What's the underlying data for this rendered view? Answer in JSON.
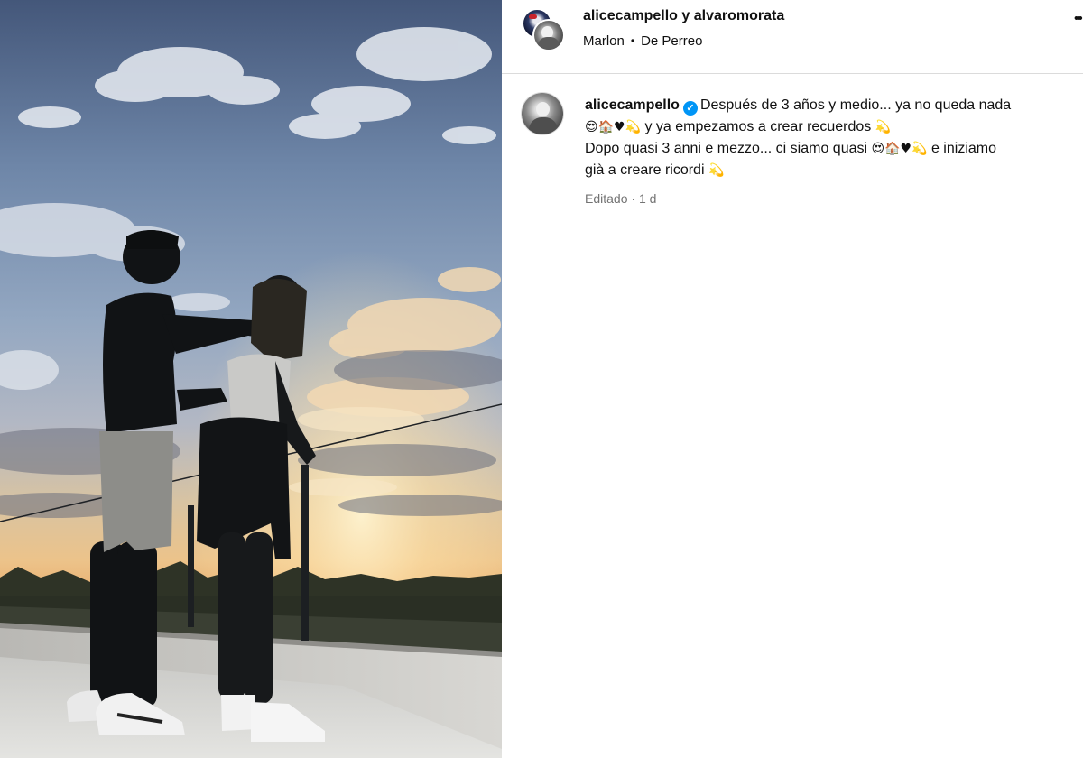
{
  "header": {
    "owners": "alicecampello y alvaromorata",
    "audio_artist": "Marlon",
    "audio_separator": "•",
    "audio_track": "De Perreo",
    "more_icon": "•••"
  },
  "caption": {
    "username": "alicecampello",
    "verified_icon": "✓",
    "line1": "Después de 3 años y medio... ya no queda nada",
    "emojis1": "😍🏠♥💫",
    "line2": " y ya empezamos a crear recuerdos ",
    "emoji2": "💫",
    "line3": "Dopo quasi 3 anni e mezzo... ci siamo quasi ",
    "emojis3": "😍🏠♥💫",
    "line3b": " e iniziamo",
    "line4": "già a creare ricordi ",
    "emoji4": "💫"
  },
  "meta": {
    "edited": "Editado",
    "separator": "·",
    "time": "1 d"
  }
}
